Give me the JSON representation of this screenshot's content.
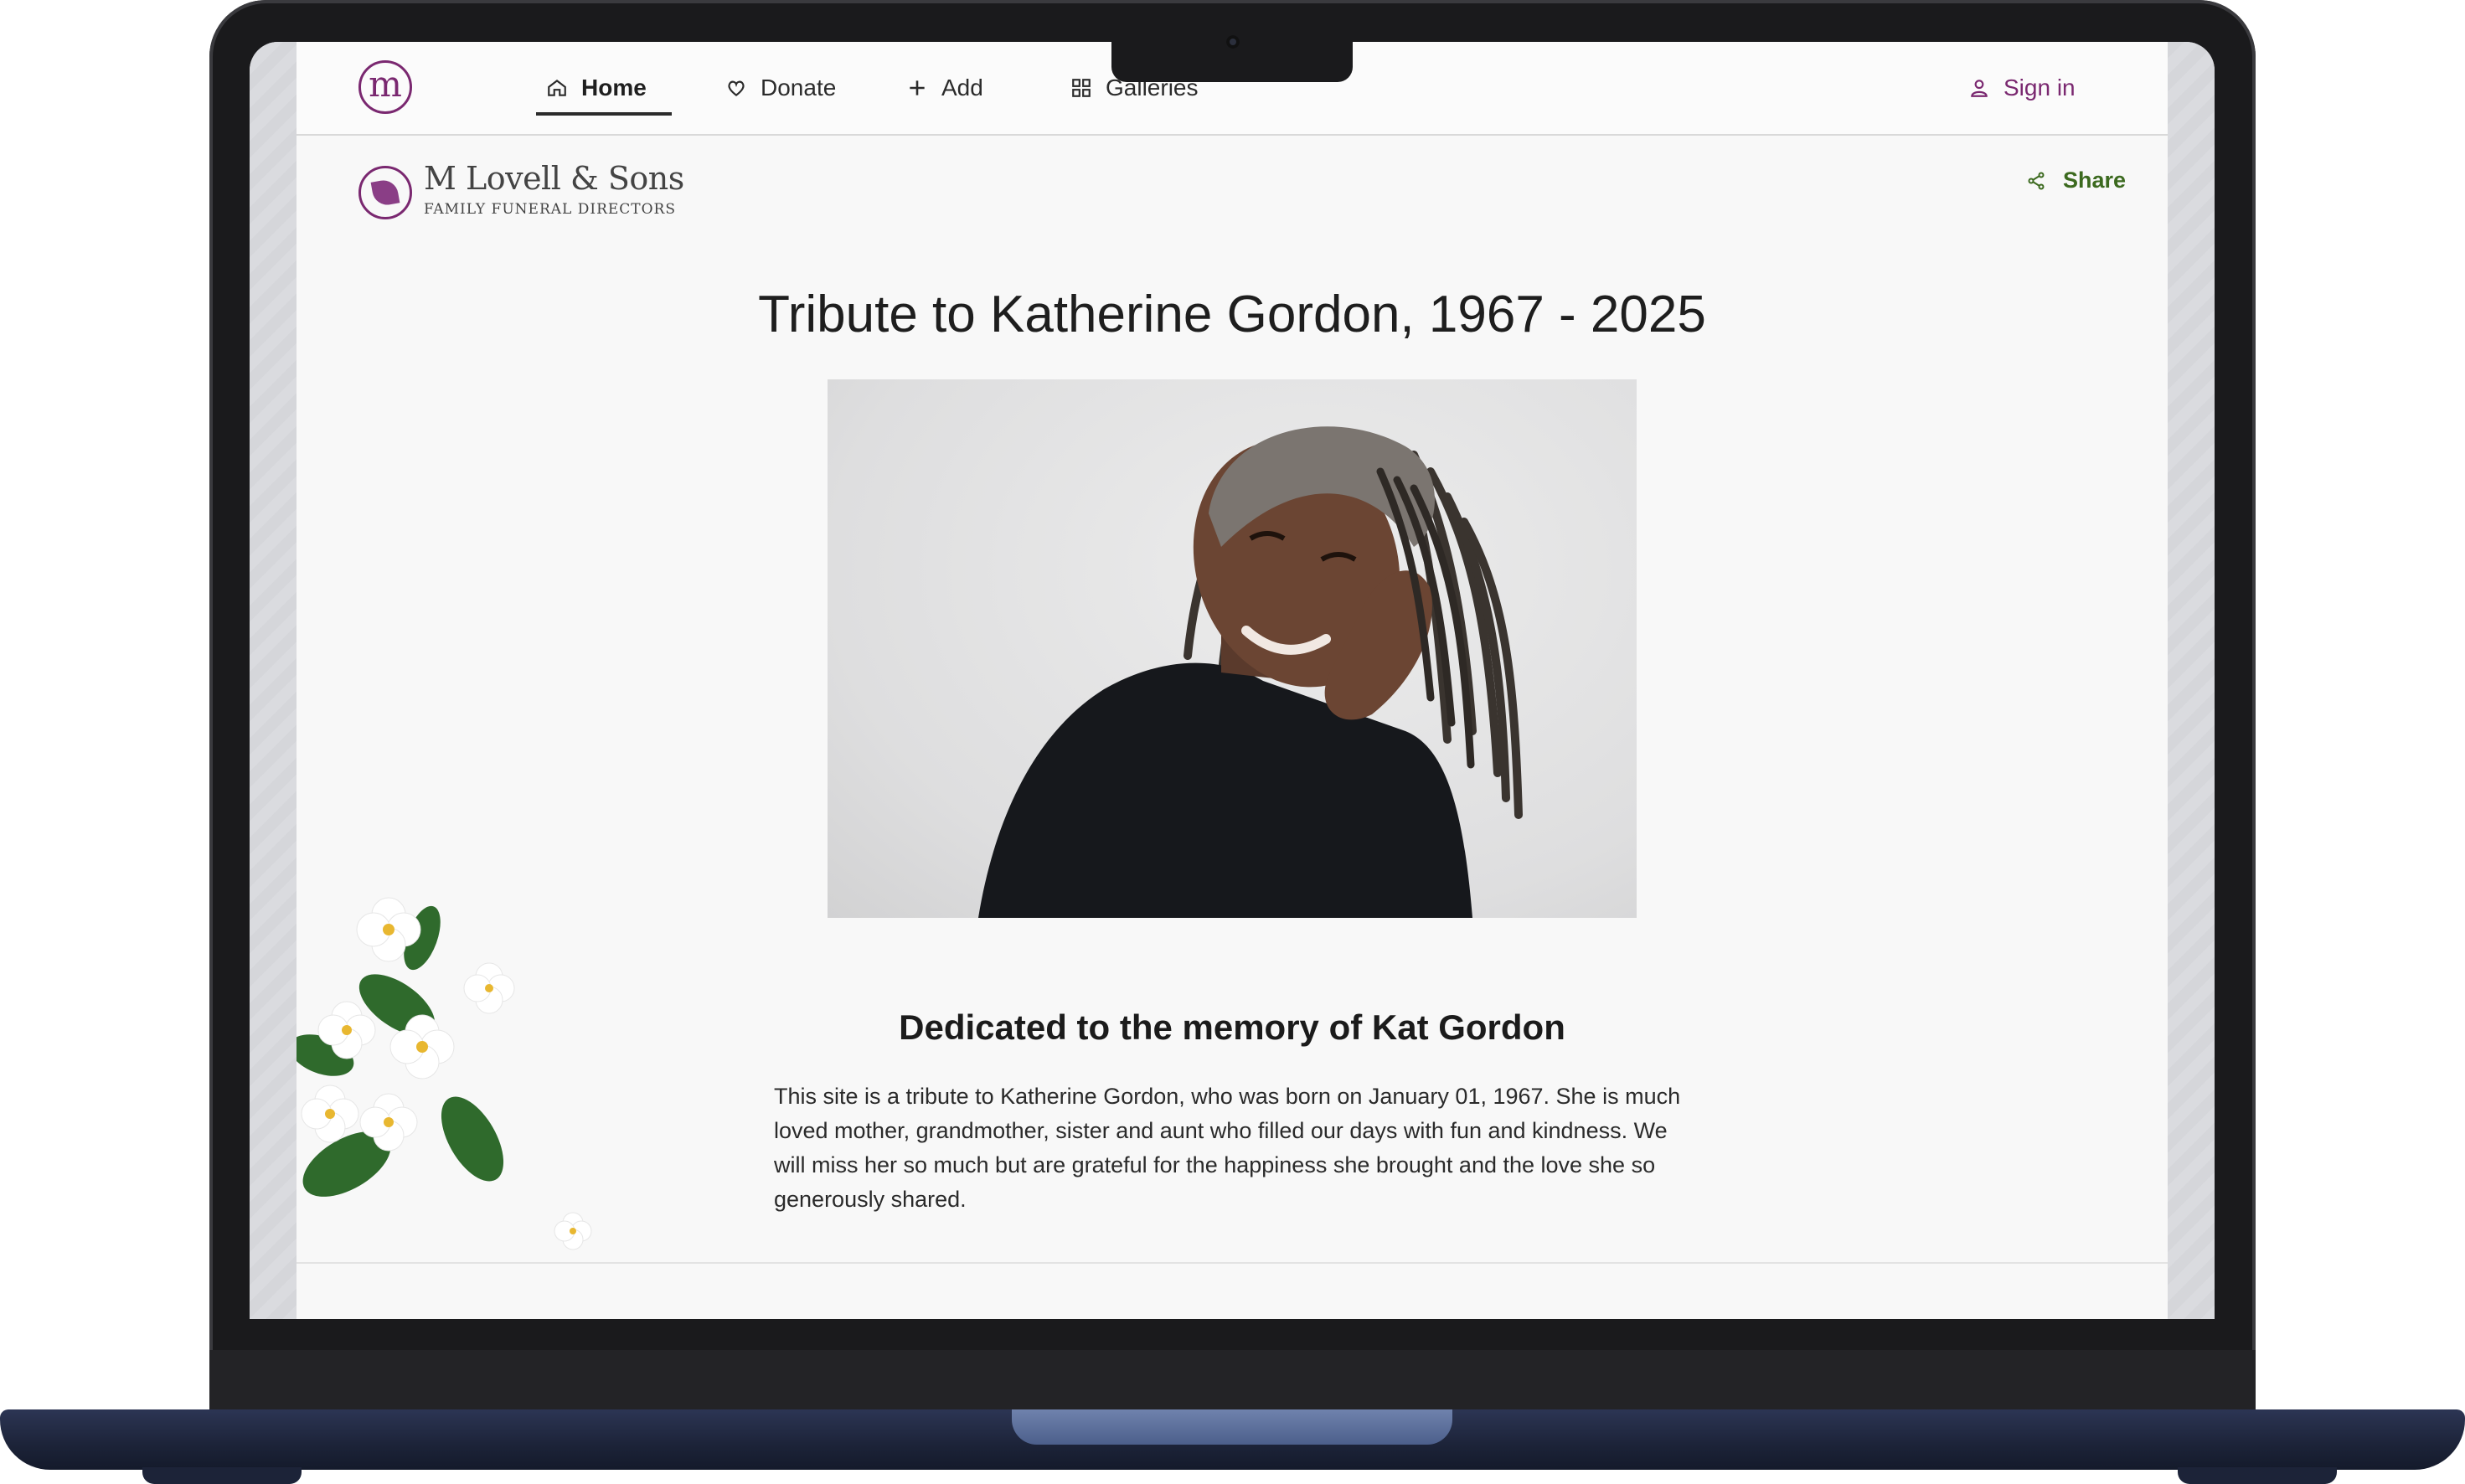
{
  "nav": {
    "logo_letter": "m",
    "items": [
      {
        "label": "Home",
        "icon": "home-icon",
        "active": true
      },
      {
        "label": "Donate",
        "icon": "heart-icon",
        "active": false
      },
      {
        "label": "Add",
        "icon": "plus-icon",
        "active": false
      },
      {
        "label": "Galleries",
        "icon": "grid-icon",
        "active": false
      }
    ],
    "sign_in": {
      "label": "Sign in",
      "icon": "user-icon"
    }
  },
  "brand": {
    "name": "M Lovell & Sons",
    "subtitle": "FAMILY FUNERAL DIRECTORS"
  },
  "share": {
    "label": "Share",
    "icon": "share-icon"
  },
  "tribute": {
    "title": "Tribute to Katherine Gordon, 1967 - 2025",
    "dedication": "Dedicated to the memory of Kat Gordon",
    "bio": "This site is a tribute to Katherine Gordon, who was born on January 01, 1967. She is much loved mother, grandmother, sister and aunt who filled our days with fun and kindness. We will miss her so much but are grateful for the happiness she brought and the love she so generously shared."
  },
  "colors": {
    "brand_purple": "#7a2870",
    "share_green": "#3c6a1f",
    "page_bg": "#f8f8f8",
    "laptop_body": "#1a1a1c",
    "laptop_base": "#1c2338"
  }
}
